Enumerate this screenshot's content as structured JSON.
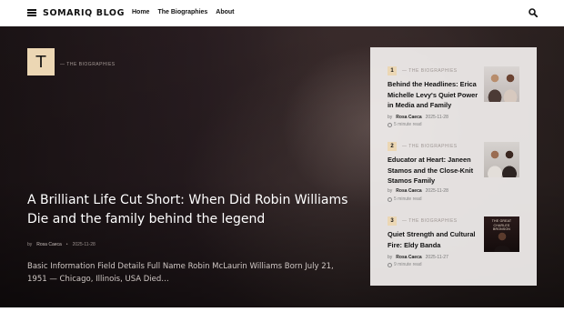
{
  "header": {
    "brand": "SOMARIQ BLOG",
    "nav": [
      "Home",
      "The Biographies",
      "About"
    ],
    "icons": {
      "menu": "menu-icon",
      "search": "search-icon"
    }
  },
  "hero": {
    "category_letter": "T",
    "category": "— THE BIOGRAPHIES",
    "title": "A Brilliant Life Cut Short: When Did Robin Williams Die and the family behind the legend",
    "meta": {
      "by": "by",
      "author": "Rosa Caeca",
      "sep": "•",
      "date": "2025-11-28"
    },
    "excerpt": "Basic Information Field Details Full Name Robin McLaurin Williams Born July 21, 1951 — Chicago, Illinois, USA Died…"
  },
  "sidebar": {
    "items": [
      {
        "rank": "1",
        "category": "— THE BIOGRAPHIES",
        "title": "Behind the Headlines: Erica Michelle Levy's Quiet Power in Media and Family",
        "by": "by",
        "author": "Rosa Caeca",
        "date": "2025-11-28",
        "read": "5 minute read"
      },
      {
        "rank": "2",
        "category": "— THE BIOGRAPHIES",
        "title": "Educator at Heart: Janeen Stamos and the Close-Knit Stamos Family",
        "by": "by",
        "author": "Rosa Caeca",
        "date": "2025-11-28",
        "read": "5 minute read"
      },
      {
        "rank": "3",
        "category": "— THE BIOGRAPHIES",
        "title": "Quiet Strength and Cultural Fire: Eldy Banda",
        "by": "by",
        "author": "Rosa Caeca",
        "date": "2025-11-27",
        "read": "9 minute read",
        "thumb_text": "THE GREAT CHARLES BRONSON"
      }
    ]
  },
  "colors": {
    "accent": "#ecd7b4",
    "header_bg": "#ffffff",
    "panel_bg": "#f2efee"
  }
}
